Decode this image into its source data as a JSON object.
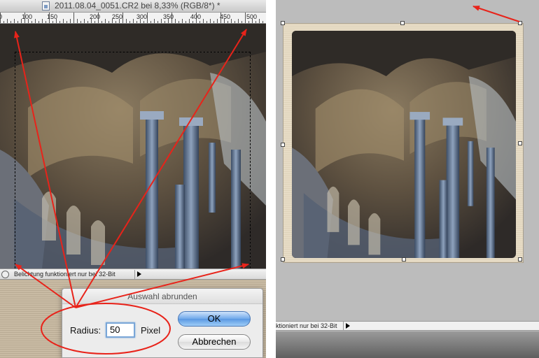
{
  "window": {
    "title": "2011.08.04_0051.CR2 bei 8,33% (RGB/8*) *"
  },
  "ruler": {
    "labels": [
      "0",
      "100",
      "150",
      "200",
      "250",
      "300",
      "350",
      "400",
      "450",
      "500"
    ]
  },
  "status_bar": {
    "left_text": "Belichtung funktioniert nur bei 32-Bit",
    "right_text": "ktioniert nur bei 32-Bit"
  },
  "dialog": {
    "title": "Auswahl abrunden",
    "radius_label": "Radius:",
    "radius_value": "50",
    "unit_label": "Pixel",
    "ok_label": "OK",
    "cancel_label": "Abbrechen"
  },
  "colors": {
    "annotation_red": "#e8231a",
    "ok_button_blue": "#6fa8ea",
    "frame_beige": "#e3d7bf"
  },
  "icons": {
    "document": "document-icon",
    "zoom": "zoom-icon",
    "status_menu": "triangle-right-icon"
  }
}
